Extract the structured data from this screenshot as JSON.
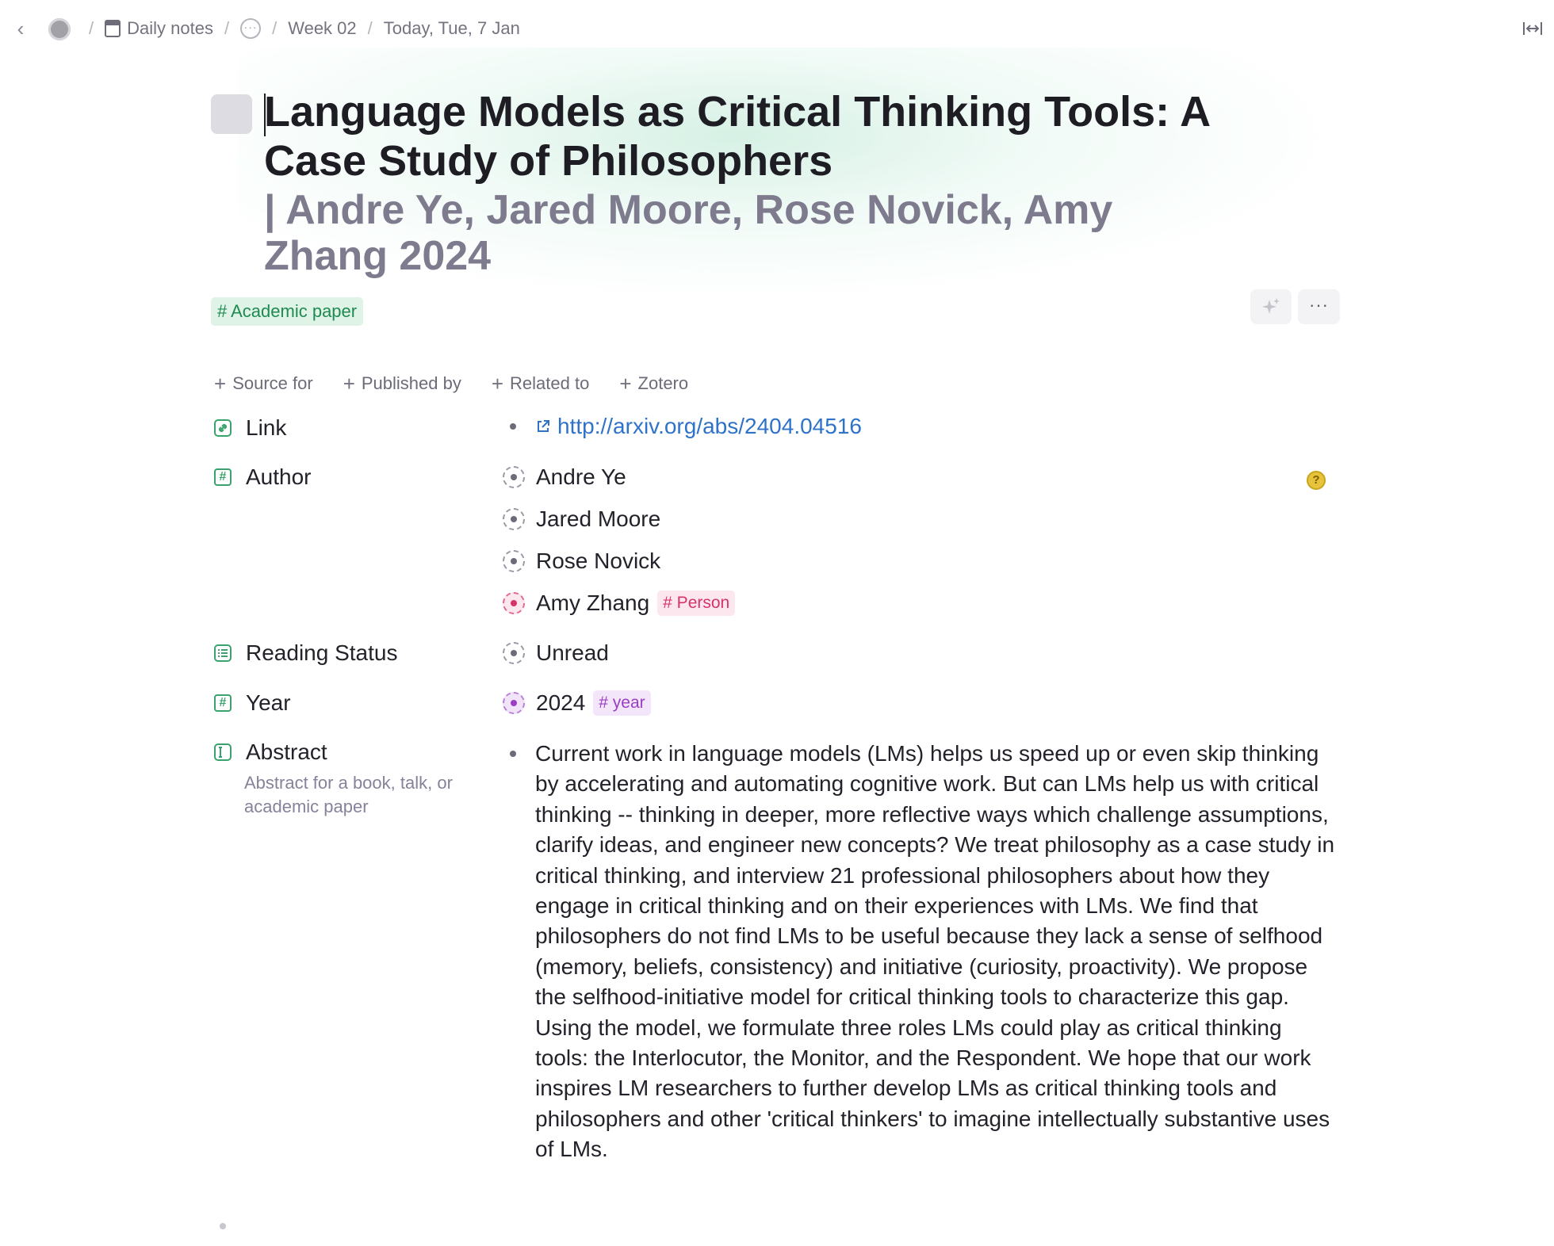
{
  "breadcrumb": {
    "back_icon": "chevron-left-icon",
    "workspace_avatar": "workspace-avatar",
    "items": [
      "Daily notes",
      "Week 02",
      "Today, Tue, 7 Jan"
    ],
    "calendar_icon": "calendar-icon",
    "hidden_icon": "ellipsis-icon",
    "expand_icon": "expand-width-icon"
  },
  "page": {
    "title": "Language Models as Critical Thinking Tools: A Case Study of Philosophers",
    "subtitle": "| Andre Ye, Jared Moore, Rose Novick, Amy Zhang 2024",
    "tag": "# Academic paper",
    "ai_icon": "sparkle-icon",
    "more_label": "···"
  },
  "relations": [
    "Source for",
    "Published by",
    "Related to",
    "Zotero"
  ],
  "properties": {
    "link": {
      "label": "Link",
      "value": "http://arxiv.org/abs/2404.04516"
    },
    "author": {
      "label": "Author",
      "values": [
        "Andre Ye",
        "Jared Moore",
        "Rose Novick",
        "Amy Zhang"
      ],
      "person_tag": "# Person",
      "help_badge": "?"
    },
    "reading_status": {
      "label": "Reading Status",
      "value": "Unread"
    },
    "year": {
      "label": "Year",
      "value": "2024",
      "tag": "# year"
    },
    "abstract": {
      "label": "Abstract",
      "description": "Abstract for a book, talk, or academic paper",
      "value": "Current work in language models (LMs) helps us speed up or even skip thinking by accelerating and automating cognitive work. But can LMs help us with critical thinking -- thinking in deeper, more reflective ways which challenge assumptions, clarify ideas, and engineer new concepts? We treat philosophy as a case study in critical thinking, and interview 21 professional philosophers about how they engage in critical thinking and on their experiences with LMs. We find that philosophers do not find LMs to be useful because they lack a sense of selfhood (memory, beliefs, consistency) and initiative (curiosity, proactivity). We propose the selfhood-initiative model for critical thinking tools to characterize this gap. Using the model, we formulate three roles LMs could play as critical thinking tools: the Interlocutor, the Monitor, and the Respondent. We hope that our work inspires LM researchers to further develop LMs as critical thinking tools and philosophers and other 'critical thinkers' to imagine intellectually substantive uses of LMs."
    }
  },
  "colors": {
    "accent_green": "#3aa36d",
    "link_blue": "#2f73c9",
    "person_pink": "#d6336c",
    "year_purple": "#9a3fc4",
    "subtitle_gray": "#7d7b8d"
  }
}
